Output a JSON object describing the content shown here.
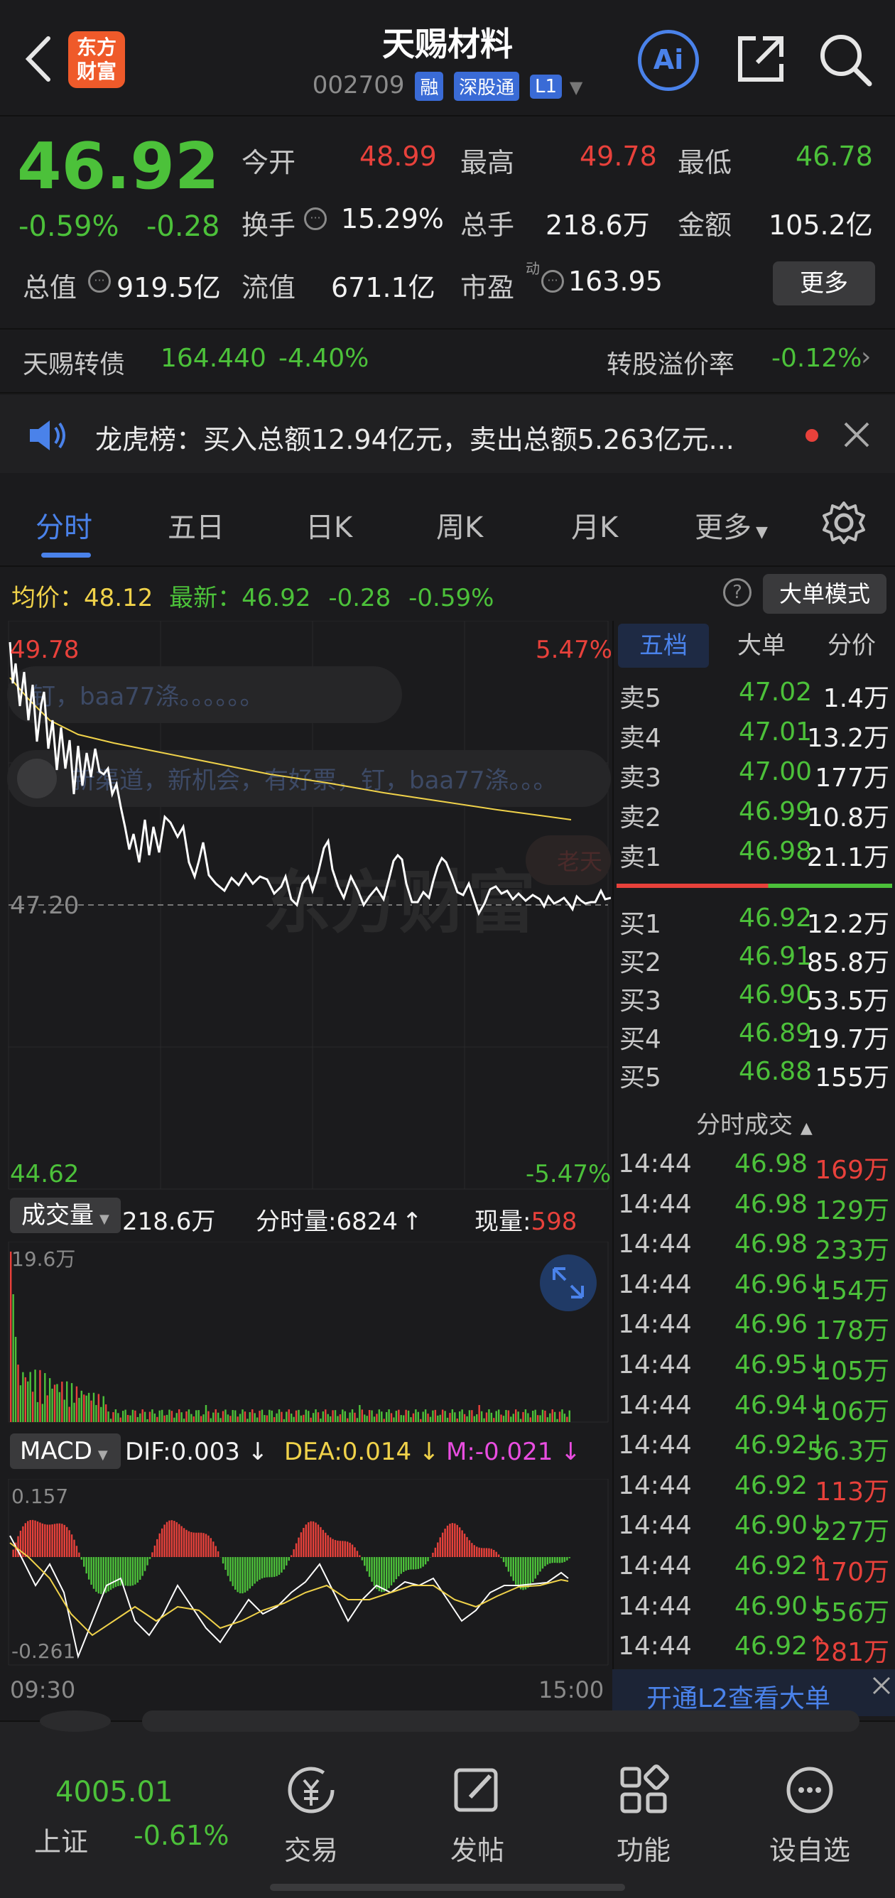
{
  "header": {
    "title": "天赐材料",
    "code": "002709",
    "tags": [
      "融",
      "深股通",
      "L1"
    ],
    "logo_text": [
      "东方",
      "财富"
    ],
    "ai_label": "Ai"
  },
  "quote": {
    "price": "46.92",
    "change_pct": "-0.59%",
    "change": "-0.28",
    "open_label": "今开",
    "open": "48.99",
    "high_label": "最高",
    "high": "49.78",
    "low_label": "最低",
    "low": "46.78",
    "turnover_label": "换手",
    "turnover": "15.29%",
    "volume_label": "总手",
    "volume": "218.6万",
    "amount_label": "金额",
    "amount": "105.2亿",
    "mktcap_label": "总值",
    "mktcap": "919.5亿",
    "float_label": "流值",
    "float": "671.1亿",
    "pe_label": "市盈",
    "pe_sup": "动",
    "pe": "163.95",
    "more_label": "更多"
  },
  "bond": {
    "name": "天赐转债",
    "price": "164.440",
    "change": "-4.40%",
    "premium_label": "转股溢价率",
    "premium": "-0.12%"
  },
  "notice": {
    "text": "龙虎榜：买入总额12.94亿元，卖出总额5.263亿元..."
  },
  "tabs": [
    "分时",
    "五日",
    "日K",
    "周K",
    "月K",
    "更多"
  ],
  "chart_header": {
    "avg_label": "均价：",
    "avg": "48.12",
    "latest_label": "最新：",
    "latest": "46.92",
    "change": "-0.28",
    "change_pct": "-0.59%",
    "mode_button": "大单模式"
  },
  "chart_labels": {
    "top_price": "49.78",
    "top_pct": "5.47%",
    "mid_price": "47.20",
    "bottom_price": "44.62",
    "bottom_pct": "-5.47%",
    "watermark": "东方财富",
    "comment1": "钉，baa77涤。。。。。。",
    "comment2": "新渠道，新机会，有好票，钉，baa77涤。。。",
    "comment3": "老天"
  },
  "volume_header": {
    "label": "成交量",
    "total": "218.6万",
    "minute_label": "分时量:",
    "minute": "6824",
    "current_label": "现量:",
    "current": "598",
    "scale": "19.6万"
  },
  "macd_header": {
    "label": "MACD",
    "dif": "DIF:0.003",
    "dea": "DEA:0.014",
    "m": "M:-0.021",
    "top": "0.157",
    "bottom": "-0.261"
  },
  "time_axis": {
    "start": "09:30",
    "end": "15:00"
  },
  "orderbook": {
    "tabs": [
      "五档",
      "大单",
      "分价"
    ],
    "asks": [
      {
        "label": "卖5",
        "price": "47.02",
        "vol": "1.4万"
      },
      {
        "label": "卖4",
        "price": "47.01",
        "vol": "13.2万"
      },
      {
        "label": "卖3",
        "price": "47.00",
        "vol": "177万"
      },
      {
        "label": "卖2",
        "price": "46.99",
        "vol": "10.8万"
      },
      {
        "label": "卖1",
        "price": "46.98",
        "vol": "21.1万"
      }
    ],
    "bids": [
      {
        "label": "买1",
        "price": "46.92",
        "vol": "12.2万"
      },
      {
        "label": "买2",
        "price": "46.91",
        "vol": "85.8万"
      },
      {
        "label": "买3",
        "price": "46.90",
        "vol": "53.5万"
      },
      {
        "label": "买4",
        "price": "46.89",
        "vol": "19.7万"
      },
      {
        "label": "买5",
        "price": "46.88",
        "vol": "155万"
      }
    ]
  },
  "trades": {
    "title": "分时成交",
    "rows": [
      {
        "time": "14:44",
        "price": "46.98",
        "vol": "169万",
        "dir": "",
        "color": "#e8413b"
      },
      {
        "time": "14:44",
        "price": "46.98",
        "vol": "129万",
        "dir": "",
        "color": "#4cc13a"
      },
      {
        "time": "14:44",
        "price": "46.98",
        "vol": "233万",
        "dir": "",
        "color": "#4cc13a"
      },
      {
        "time": "14:44",
        "price": "46.96",
        "vol": "154万",
        "dir": "↓",
        "color": "#4cc13a"
      },
      {
        "time": "14:44",
        "price": "46.96",
        "vol": "178万",
        "dir": "",
        "color": "#4cc13a"
      },
      {
        "time": "14:44",
        "price": "46.95",
        "vol": "105万",
        "dir": "↓",
        "color": "#4cc13a"
      },
      {
        "time": "14:44",
        "price": "46.94",
        "vol": "106万",
        "dir": "↓",
        "color": "#4cc13a"
      },
      {
        "time": "14:44",
        "price": "46.92",
        "vol": "56.3万",
        "dir": "↓",
        "color": "#4cc13a"
      },
      {
        "time": "14:44",
        "price": "46.92",
        "vol": "113万",
        "dir": "",
        "color": "#e8413b"
      },
      {
        "time": "14:44",
        "price": "46.90",
        "vol": "227万",
        "dir": "↓",
        "color": "#4cc13a"
      },
      {
        "time": "14:44",
        "price": "46.92",
        "vol": "170万",
        "dir": "↑",
        "color": "#e8413b"
      },
      {
        "time": "14:44",
        "price": "46.90",
        "vol": "556万",
        "dir": "↓",
        "color": "#4cc13a"
      },
      {
        "time": "14:44",
        "price": "46.92",
        "vol": "281万",
        "dir": "↑",
        "color": "#e8413b"
      }
    ],
    "l2_prompt": "开通L2查看大单"
  },
  "bottom_nav": {
    "index_value": "4005.01",
    "index_name": "上证",
    "index_change": "-0.61%",
    "items": [
      "交易",
      "发帖",
      "功能",
      "设自选"
    ]
  },
  "colors": {
    "up": "#e8413b",
    "down": "#4cc13a",
    "avg_line": "#f0d24a",
    "accent": "#3a6bd6"
  }
}
